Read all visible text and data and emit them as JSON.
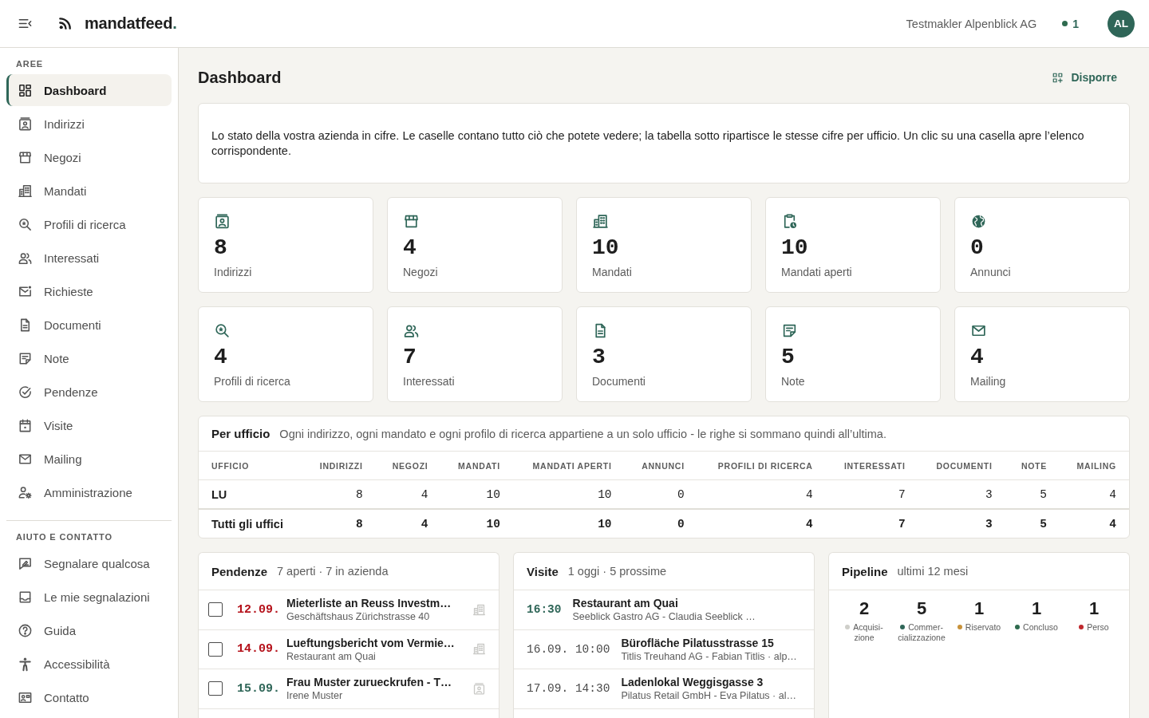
{
  "header": {
    "brand": {
      "name": "mandatfeed",
      "accent": "."
    },
    "account": "Testmakler Alpenblick AG",
    "status_count": "1",
    "avatar": "AL"
  },
  "sidebar": {
    "sections": [
      {
        "title": "AREE",
        "items": [
          {
            "label": "Dashboard",
            "selected": true
          },
          {
            "label": "Indirizzi",
            "selected": false
          },
          {
            "label": "Negozi",
            "selected": false
          },
          {
            "label": "Mandati",
            "selected": false
          },
          {
            "label": "Profili di ricerca",
            "selected": false
          },
          {
            "label": "Interessati",
            "selected": false
          },
          {
            "label": "Richieste",
            "selected": false
          },
          {
            "label": "Documenti",
            "selected": false
          },
          {
            "label": "Note",
            "selected": false
          },
          {
            "label": "Pendenze",
            "selected": false
          },
          {
            "label": "Visite",
            "selected": false
          },
          {
            "label": "Mailing",
            "selected": false
          },
          {
            "label": "Amministrazione",
            "selected": false
          }
        ]
      },
      {
        "title": "AIUTO E CONTATTO",
        "items": [
          {
            "label": "Segnalare qualcosa",
            "selected": false
          },
          {
            "label": "Le mie segnalazioni",
            "selected": false
          },
          {
            "label": "Guida",
            "selected": false
          },
          {
            "label": "Accessibilità",
            "selected": false
          },
          {
            "label": "Contatto",
            "selected": false
          }
        ]
      }
    ]
  },
  "page": {
    "title": "Dashboard",
    "arrange_button": "Disporre",
    "intro": "Lo stato della vostra azienda in cifre. Le caselle contano tutto ciò che potete vedere; la tabella sotto ripartisce le stesse cifre per ufficio. Un clic su una casella apre l’elenco corrispondente."
  },
  "tiles": [
    {
      "value": "8",
      "label": "Indirizzi"
    },
    {
      "value": "4",
      "label": "Negozi"
    },
    {
      "value": "10",
      "label": "Mandati"
    },
    {
      "value": "10",
      "label": "Mandati aperti"
    },
    {
      "value": "0",
      "label": "Annunci"
    },
    {
      "value": "4",
      "label": "Profili di ricerca"
    },
    {
      "value": "7",
      "label": "Interessati"
    },
    {
      "value": "3",
      "label": "Documenti"
    },
    {
      "value": "5",
      "label": "Note"
    },
    {
      "value": "4",
      "label": "Mailing"
    }
  ],
  "office_table": {
    "title": "Per ufficio",
    "subtitle": "Ogni indirizzo, ogni mandato e ogni profilo di ricerca appartiene a un solo ufficio - le righe si sommano quindi all’ultima.",
    "columns": [
      "UFFICIO",
      "INDIRIZZI",
      "NEGOZI",
      "MANDATI",
      "MANDATI APERTI",
      "ANNUNCI",
      "PROFILI DI RICERCA",
      "INTERESSATI",
      "DOCUMENTI",
      "NOTE",
      "MAILING"
    ],
    "rows": [
      {
        "total": false,
        "cells": [
          "LU",
          "8",
          "4",
          "10",
          "10",
          "0",
          "4",
          "7",
          "3",
          "5",
          "4"
        ]
      },
      {
        "total": true,
        "cells": [
          "Tutti gli uffici",
          "8",
          "4",
          "10",
          "10",
          "0",
          "4",
          "7",
          "3",
          "5",
          "4"
        ]
      }
    ]
  },
  "tasks": {
    "title": "Pendenze",
    "summary": "7 aperti · 7 in azienda",
    "items": [
      {
        "checked": false,
        "date": "12.09.",
        "overdue": true,
        "title": "Mieterliste an Reuss Investm…",
        "subtitle": "Geschäftshaus Zürichstrasse 40",
        "kind": "building"
      },
      {
        "checked": false,
        "date": "14.09.",
        "overdue": true,
        "title": "Lueftungsbericht vom Vermie…",
        "subtitle": "Restaurant am Quai",
        "kind": "building"
      },
      {
        "checked": false,
        "date": "15.09.",
        "overdue": false,
        "title": "Frau Muster zurueckrufen - T…",
        "subtitle": "Irene Muster",
        "kind": "contact"
      }
    ]
  },
  "visits": {
    "title": "Visite",
    "summary": "1 oggi · 5 prossime",
    "items": [
      {
        "time": "16:30",
        "today": true,
        "title": "Restaurant am Quai",
        "subtitle": "Seeblick Gastro AG - Claudia Seeblick …"
      },
      {
        "time": "16.09. 10:00",
        "today": false,
        "title": "Bürofläche Pilatusstrasse 15",
        "subtitle": "Titlis Treuhand AG - Fabian Titlis · alp…"
      },
      {
        "time": "17.09. 14:30",
        "today": false,
        "title": "Ladenlokal Weggisgasse 3",
        "subtitle": "Pilatus Retail GmbH - Eva Pilatus · al…"
      }
    ]
  },
  "pipeline": {
    "title": "Pipeline",
    "summary": "ultimi 12 mesi",
    "stages": [
      {
        "count": "2",
        "label": "Acquisi-zione",
        "color": "#cfcfca"
      },
      {
        "count": "5",
        "label": "Commer-cializzazione",
        "color": "#2f6658"
      },
      {
        "count": "1",
        "label": "Riservato",
        "color": "#c8923a"
      },
      {
        "count": "1",
        "label": "Concluso",
        "color": "#2e6b4f"
      },
      {
        "count": "1",
        "label": "Perso",
        "color": "#c0282d"
      }
    ]
  }
}
